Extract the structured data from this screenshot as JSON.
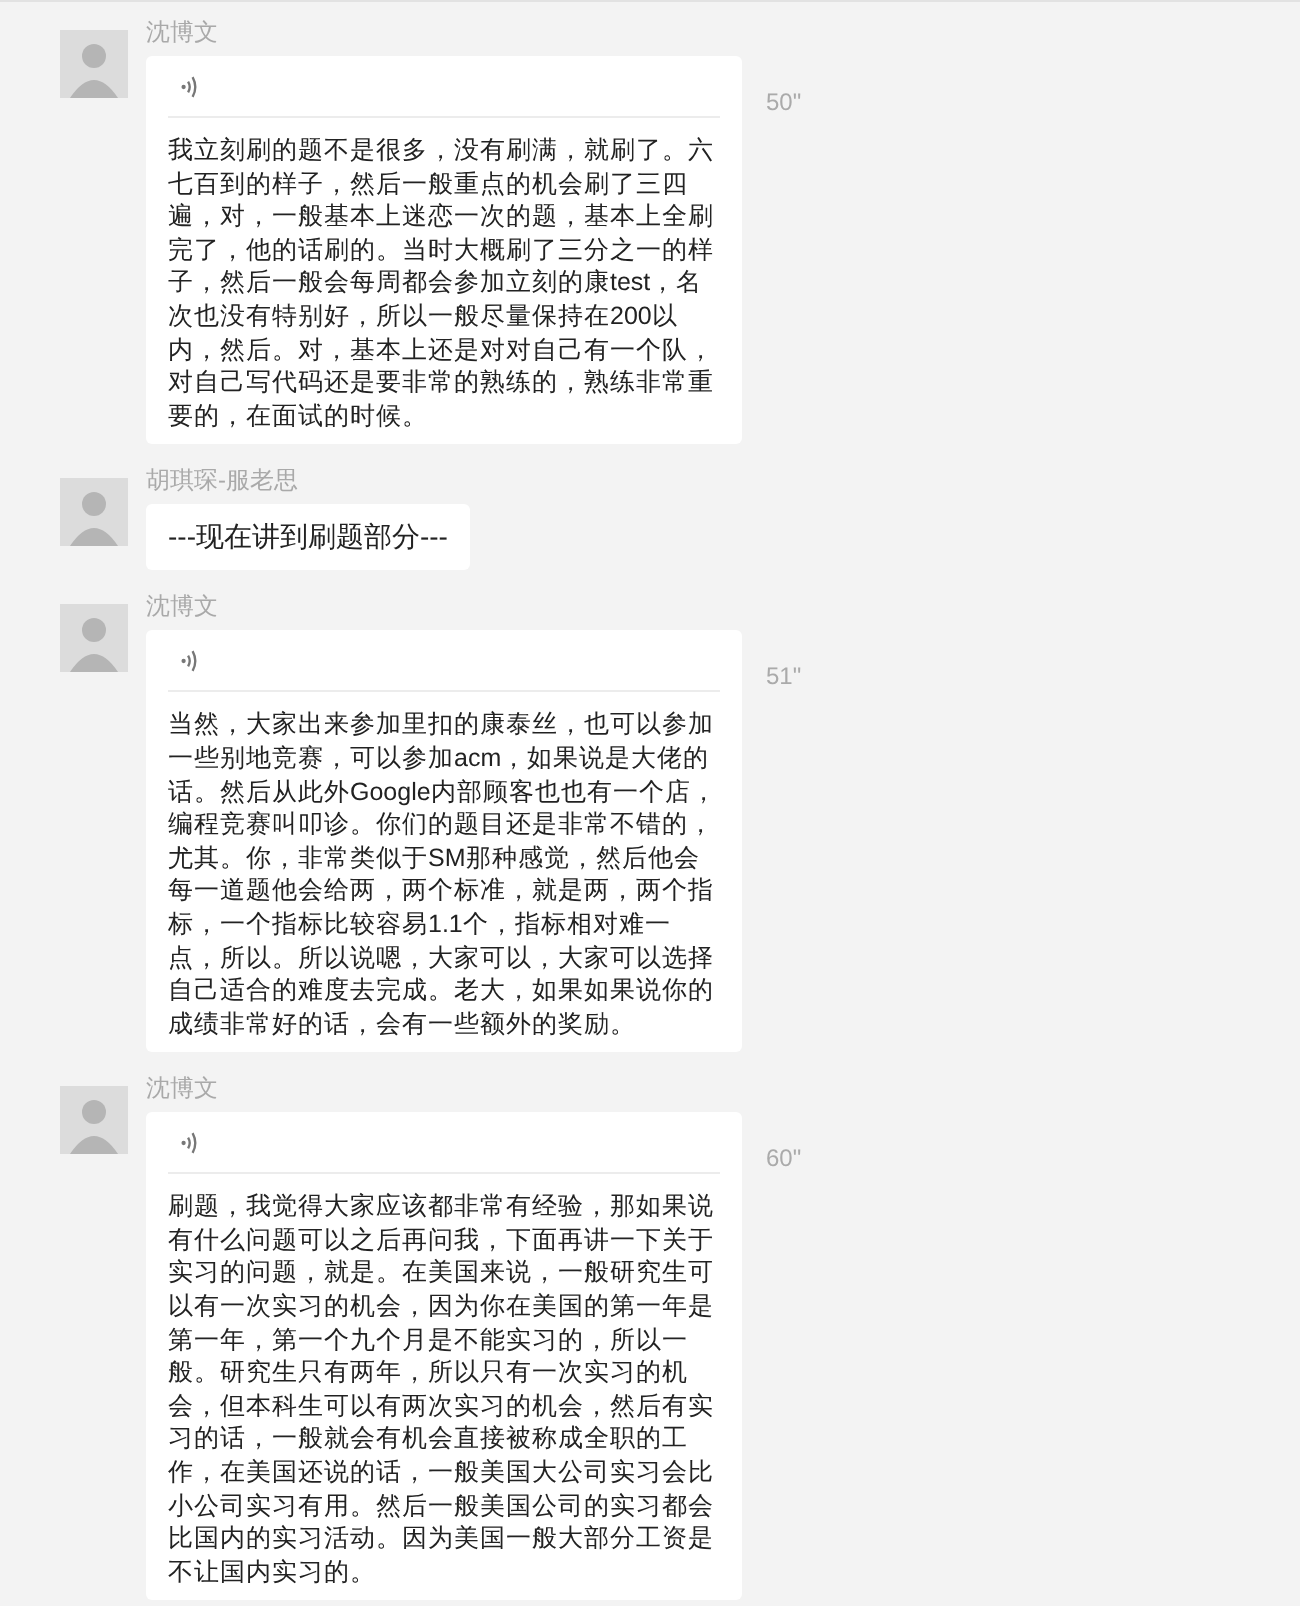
{
  "messages": [
    {
      "kind": "voice",
      "sender": "沈博文",
      "duration": "50\"",
      "transcript": "我立刻刷的题不是很多，没有刷满，就刷了。六七百到的样子，然后一般重点的机会刷了三四遍，对，一般基本上迷恋一次的题，基本上全刷完了，他的话刷的。当时大概刷了三分之一的样子，然后一般会每周都会参加立刻的康test，名次也没有特别好，所以一般尽量保持在200以内，然后。对，基本上还是对对自己有一个队，对自己写代码还是要非常的熟练的，熟练非常重要的，在面试的时候。"
    },
    {
      "kind": "text",
      "sender": "胡琪琛-服老思",
      "text": "---现在讲到刷题部分---"
    },
    {
      "kind": "voice",
      "sender": "沈博文",
      "duration": "51\"",
      "transcript": "当然，大家出来参加里扣的康泰丝，也可以参加一些别地竞赛，可以参加acm，如果说是大佬的话。然后从此外Google内部顾客也也有一个店，编程竞赛叫叩诊。你们的题目还是非常不错的，尤其。你，非常类似于SM那种感觉，然后他会每一道题他会给两，两个标准，就是两，两个指标，一个指标比较容易1.1个，指标相对难一点，所以。所以说嗯，大家可以，大家可以选择自己适合的难度去完成。老大，如果如果说你的成绩非常好的话，会有一些额外的奖励。"
    },
    {
      "kind": "voice",
      "sender": "沈博文",
      "duration": "60\"",
      "transcript": "刷题，我觉得大家应该都非常有经验，那如果说有什么问题可以之后再问我，下面再讲一下关于实习的问题，就是。在美国来说，一般研究生可以有一次实习的机会，因为你在美国的第一年是第一年，第一个九个月是不能实习的，所以一般。研究生只有两年，所以只有一次实习的机会，但本科生可以有两次实习的机会，然后有实习的话，一般就会有机会直接被称成全职的工作，在美国还说的话，一般美国大公司实习会比小公司实习有用。然后一般美国公司的实习都会比国内的实习活动。因为美国一般大部分工资是不让国内实习的。"
    }
  ]
}
